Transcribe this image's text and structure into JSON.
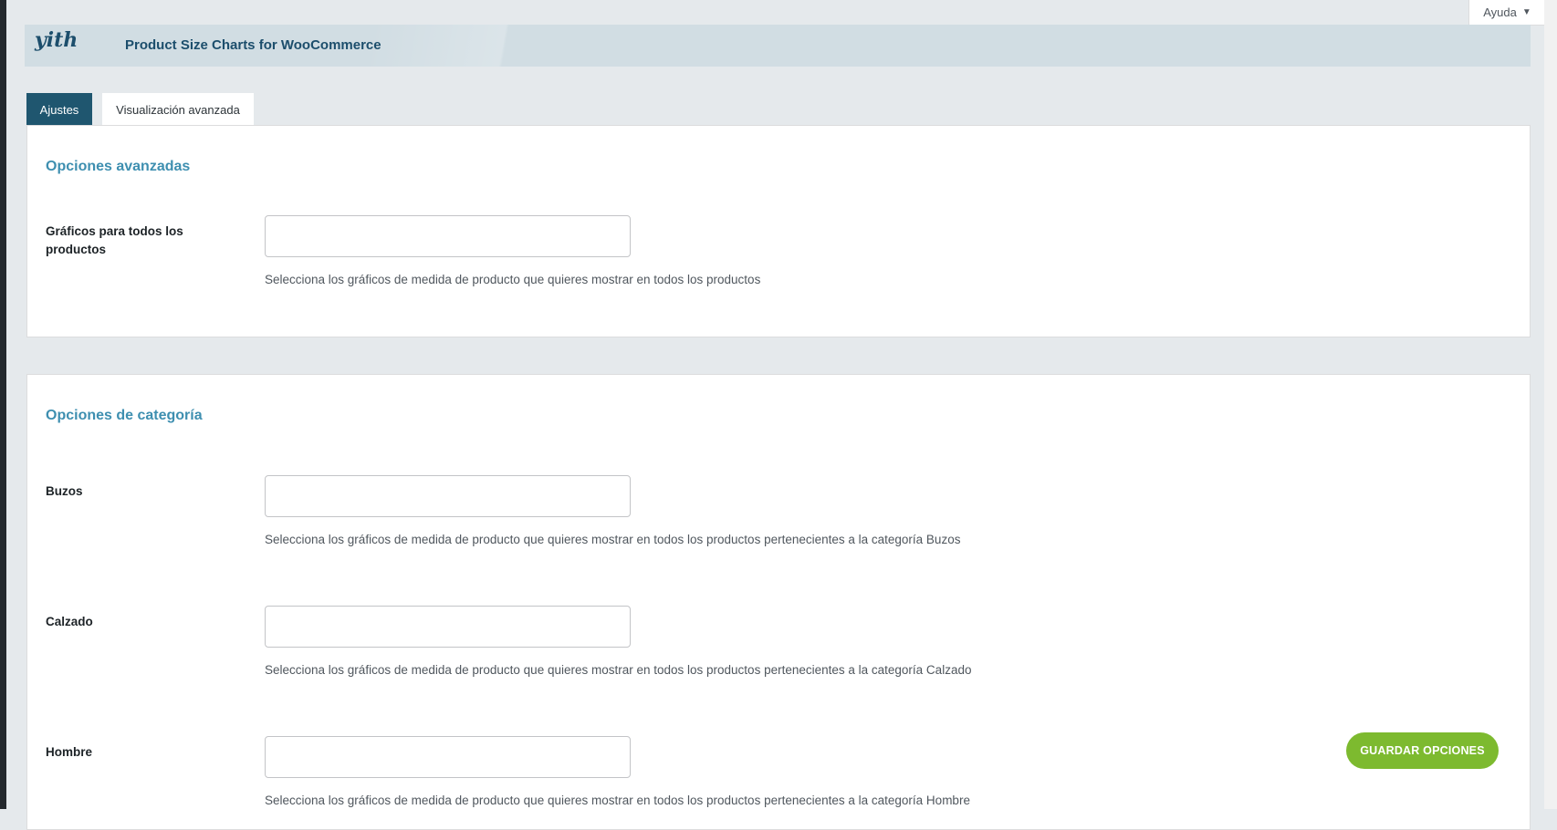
{
  "help": {
    "label": "Ayuda",
    "caret": "▼"
  },
  "banner": {
    "logo": "yith",
    "title": "Product Size Charts for WooCommerce"
  },
  "tabs": [
    {
      "label": "Ajustes",
      "active": true
    },
    {
      "label": "Visualización avanzada",
      "active": false
    }
  ],
  "sections": [
    {
      "title": "Opciones avanzadas",
      "fields": [
        {
          "label": "Gráficos para todos los productos",
          "value": "",
          "description": "Selecciona los gráficos de medida de producto que quieres mostrar en todos los productos"
        }
      ]
    },
    {
      "title": "Opciones de categoría",
      "fields": [
        {
          "label": "Buzos",
          "value": "",
          "description": "Selecciona los gráficos de medida de producto que quieres mostrar en todos los productos pertenecientes a la categoría Buzos"
        },
        {
          "label": "Calzado",
          "value": "",
          "description": "Selecciona los gráficos de medida de producto que quieres mostrar en todos los productos pertenecientes a la categoría Calzado"
        },
        {
          "label": "Hombre",
          "value": "",
          "description": "Selecciona los gráficos de medida de producto que quieres mostrar en todos los productos pertenecientes a la categoría Hombre"
        }
      ]
    }
  ],
  "actions": {
    "save_label": "GUARDAR OPCIONES"
  },
  "colors": {
    "accent": "#3e8fb0",
    "tab_active": "#1f566f",
    "save": "#7dba2f"
  }
}
